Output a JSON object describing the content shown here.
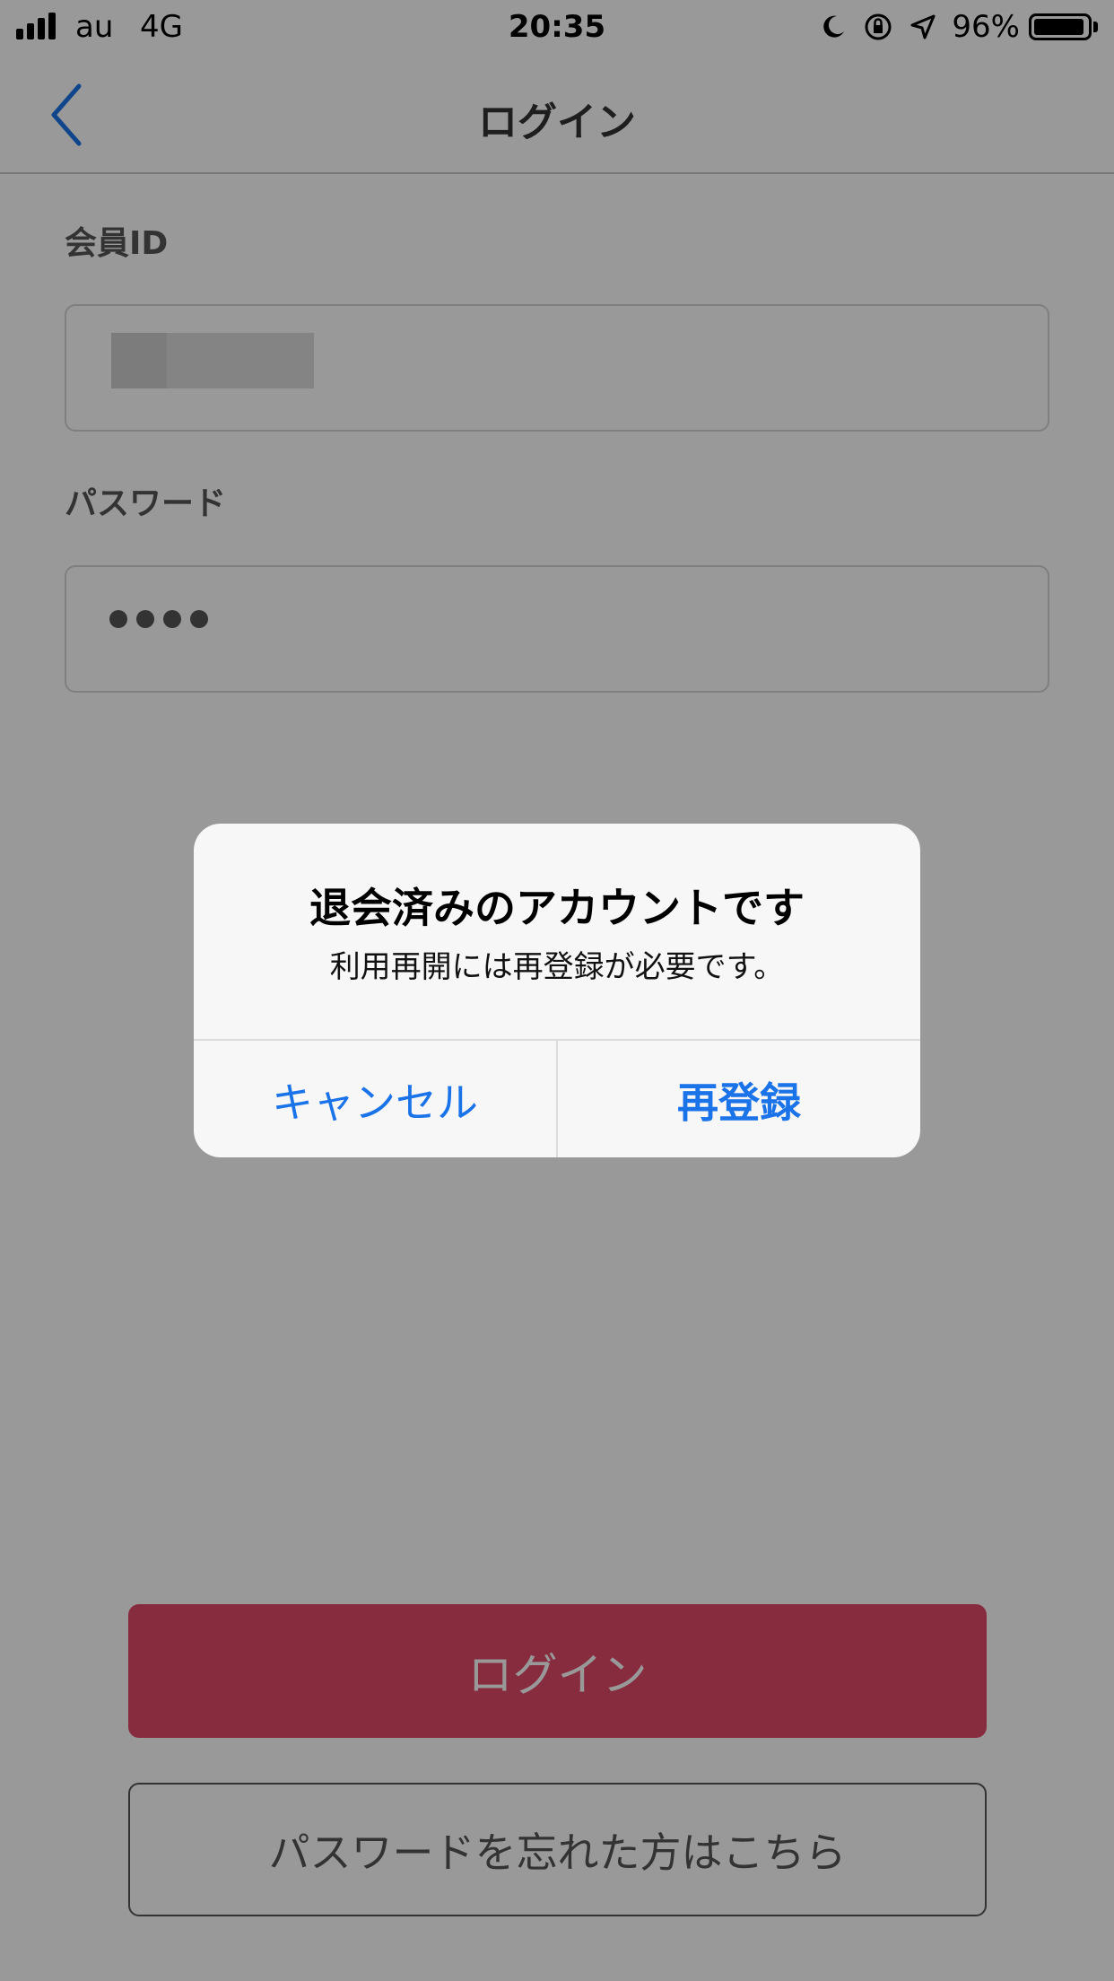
{
  "status_bar": {
    "carrier": "au",
    "network": "4G",
    "time": "20:35",
    "battery_percent": "96%",
    "battery_level": 0.96,
    "icons": [
      "moon-icon",
      "rotation-lock-icon",
      "location-arrow-icon"
    ]
  },
  "nav": {
    "title": "ログイン",
    "back_icon": "chevron-left-icon"
  },
  "form": {
    "member_id_label": "会員ID",
    "password_label": "パスワード",
    "password_dot_count": 4
  },
  "buttons": {
    "login_label": "ログイン",
    "forgot_password_label": "パスワードを忘れた方はこちら"
  },
  "alert": {
    "title": "退会済みのアカウントです",
    "message": "利用再開には再登録が必要です。",
    "cancel_label": "キャンセル",
    "reregister_label": "再登録"
  },
  "colors": {
    "accent_blue": "#1a73e8",
    "login_button": "#e04a68",
    "overlay": "rgba(0,0,0,0.40)"
  }
}
